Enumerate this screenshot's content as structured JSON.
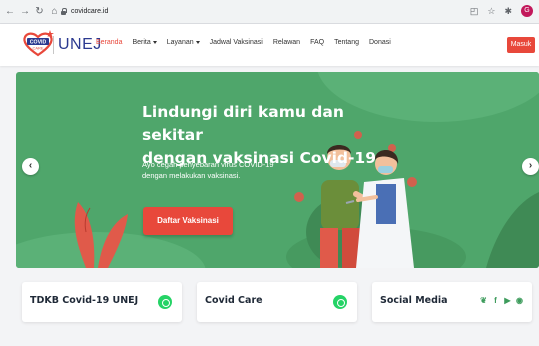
{
  "browser": {
    "url": "covidcare.id",
    "profile_initial": "G"
  },
  "header": {
    "logo_mark": "COVID CARE",
    "logo_text": "UNEJ",
    "menu": [
      {
        "label": "Beranda",
        "active": true,
        "dropdown": false
      },
      {
        "label": "Berita",
        "active": false,
        "dropdown": true
      },
      {
        "label": "Layanan",
        "active": false,
        "dropdown": true
      },
      {
        "label": "Jadwal Vaksinasi",
        "active": false,
        "dropdown": false
      },
      {
        "label": "Relawan",
        "active": false,
        "dropdown": false
      },
      {
        "label": "FAQ",
        "active": false,
        "dropdown": false
      },
      {
        "label": "Tentang",
        "active": false,
        "dropdown": false
      },
      {
        "label": "Donasi",
        "active": false,
        "dropdown": false
      }
    ],
    "login_label": "Masuk"
  },
  "hero": {
    "title_line1": "Lindungi diri kamu dan sekitar",
    "title_line2": "dengan vaksinasi Covid-19",
    "subtitle_line1": "Ayo cegah penyebaran virus COVID-19",
    "subtitle_line2": "dengan melakukan vaksinasi.",
    "cta_label": "Daftar Vaksinasi",
    "prev_icon": "chevron-left-icon",
    "next_icon": "chevron-right-icon"
  },
  "cards": [
    {
      "title": "TDKB Covid-19 UNEJ",
      "icon": "whatsapp-icon"
    },
    {
      "title": "Covid Care",
      "icon": "whatsapp-icon"
    },
    {
      "title": "Social Media",
      "icons": [
        "twitter-icon",
        "facebook-icon",
        "youtube-icon",
        "instagram-icon"
      ]
    }
  ],
  "colors": {
    "brand_red": "#e8483b",
    "hero_green": "#4fa66b",
    "brand_blue": "#2b3990",
    "whatsapp_green": "#25d366"
  }
}
